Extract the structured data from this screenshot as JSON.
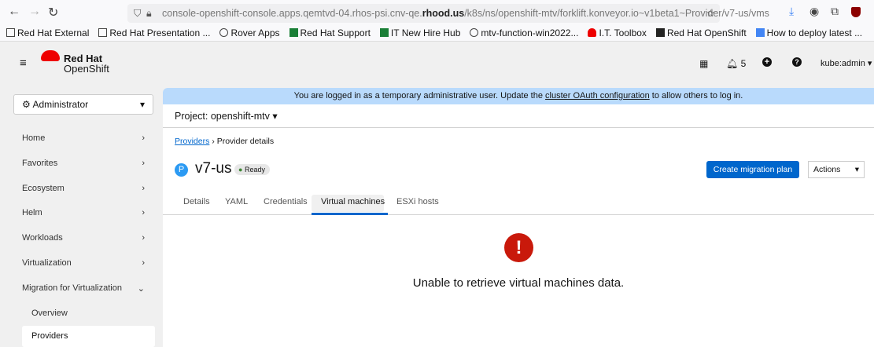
{
  "browser": {
    "url_prefix": "console-openshift-console.apps.qemtvd-04.rhos-psi.cnv-qe.",
    "url_domain": "rhood.us",
    "url_suffix": "/k8s/ns/openshift-mtv/forklift.konveyor.io~v1beta1~Provider/v7-us/vms"
  },
  "bookmarks": [
    "Red Hat External",
    "Red Hat Presentation ...",
    "Rover Apps",
    "Red Hat Support",
    "IT New Hire Hub",
    "mtv-function-win2022...",
    "I.T. Toolbox",
    "Red Hat OpenShift",
    "How to deploy latest ..."
  ],
  "masthead": {
    "brand_line1": "Red Hat",
    "brand_line2": "OpenShift",
    "notifications": "5",
    "user": "kube:admin"
  },
  "sidebar": {
    "perspective": "Administrator",
    "items": [
      "Home",
      "Favorites",
      "Ecosystem",
      "Helm",
      "Workloads",
      "Virtualization",
      "Migration for Virtualization"
    ],
    "subitems": [
      "Overview",
      "Providers"
    ]
  },
  "banner": {
    "text_before": "You are logged in as a temporary administrative user. Update the ",
    "link": "cluster OAuth configuration",
    "text_after": " to allow others to log in."
  },
  "project": "Project: openshift-mtv",
  "breadcrumb": {
    "link": "Providers",
    "current": "Provider details"
  },
  "provider": {
    "badge": "P",
    "name": "v7-us",
    "status": "Ready"
  },
  "actions": {
    "create": "Create migration plan",
    "actions": "Actions"
  },
  "tabs": [
    "Details",
    "YAML",
    "Credentials",
    "Virtual machines",
    "ESXi hosts"
  ],
  "error": {
    "message": "Unable to retrieve virtual machines data."
  },
  "colors": {
    "primary": "#0066cc",
    "danger": "#c9190b",
    "banner": "#b9dafc"
  }
}
